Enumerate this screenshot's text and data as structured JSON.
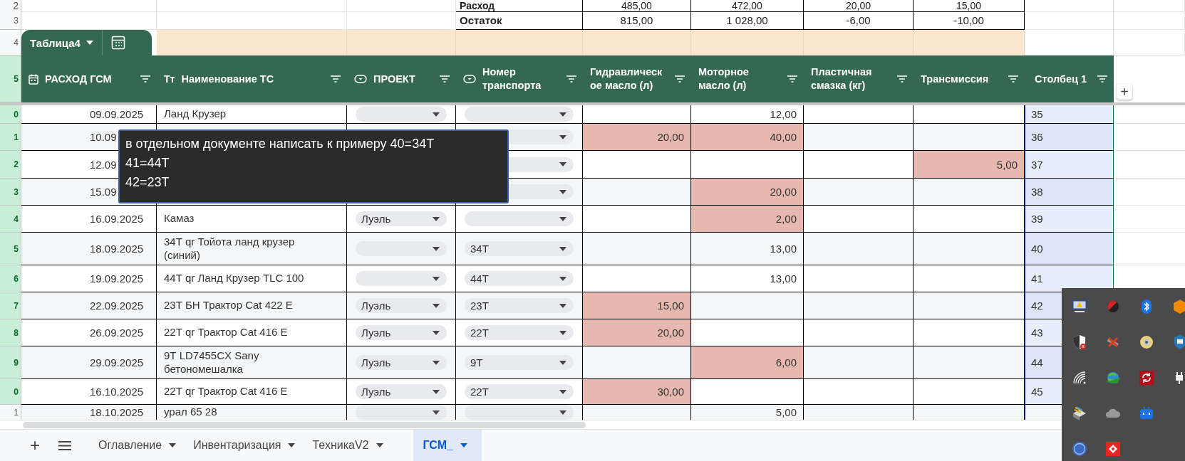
{
  "summary_rows": [
    {
      "row": "2",
      "label": "Расход",
      "values": [
        "485,00",
        "472,00",
        "20,00",
        "15,00"
      ]
    },
    {
      "row": "3",
      "label": "Остаток",
      "values": [
        "815,00",
        "1 028,00",
        "-6,00",
        "-10,00"
      ]
    }
  ],
  "table_tab": {
    "row": "4",
    "name": "Таблица4"
  },
  "header": {
    "row": "5",
    "add_column": "+",
    "columns": [
      {
        "label": "РАСХОД ГСМ",
        "kind": "date"
      },
      {
        "label": "Наименование ТС",
        "kind": "text",
        "icon_text": "Тт"
      },
      {
        "label": "ПРОЕКТ",
        "kind": "dropdown"
      },
      {
        "label": "Номер транспорта",
        "kind": "dropdown"
      },
      {
        "label": "Гидравлическое масло (л)",
        "kind": "plain"
      },
      {
        "label": "Моторное масло (л)",
        "kind": "plain"
      },
      {
        "label": "Пластичная смазка (кг)",
        "kind": "plain"
      },
      {
        "label": "Трансмиссия",
        "kind": "plain"
      },
      {
        "label": "Столбец 1",
        "kind": "centered"
      }
    ]
  },
  "rows": [
    {
      "row": "0",
      "selected": true,
      "date": "09.09.2025",
      "name": "Ланд Крузер",
      "values": [
        {
          "highlighted": false
        },
        {
          "text": "12,00",
          "highlighted": false
        },
        {
          "highlighted": false
        },
        {
          "highlighted": false
        }
      ],
      "index": {
        "text": "35",
        "selected": true
      }
    },
    {
      "row": "1",
      "selected": true,
      "date": "10.09",
      "values": [
        {
          "text": "20,00",
          "highlighted": true
        },
        {
          "text": "40,00",
          "highlighted": true
        },
        {
          "highlighted": false
        },
        {
          "highlighted": false
        }
      ],
      "index": {
        "text": "36",
        "selected": true
      }
    },
    {
      "row": "2",
      "selected": true,
      "date": "12.09",
      "values": [
        {
          "highlighted": false
        },
        {
          "highlighted": false
        },
        {
          "highlighted": false
        },
        {
          "text": "5,00",
          "highlighted": true
        }
      ],
      "index": {
        "text": "37",
        "selected": true
      }
    },
    {
      "row": "3",
      "selected": true,
      "date": "15.09",
      "values": [
        {
          "highlighted": false
        },
        {
          "text": "20,00",
          "highlighted": true
        },
        {
          "highlighted": false
        },
        {
          "highlighted": false
        }
      ],
      "index": {
        "text": "38",
        "selected": true
      }
    },
    {
      "row": "4",
      "selected": true,
      "date": "16.09.2025",
      "name": "Камаз",
      "project": "Луэль",
      "values": [
        {
          "highlighted": false
        },
        {
          "text": "2,00",
          "highlighted": true
        },
        {
          "highlighted": false
        },
        {
          "highlighted": false
        }
      ],
      "index": {
        "text": "39",
        "selected": true
      }
    },
    {
      "row": "5",
      "selected": true,
      "date": "18.09.2025",
      "name": "34Т qr Тойота ланд крузер (синий)",
      "number": "34Т",
      "values": [
        {
          "highlighted": false
        },
        {
          "text": "13,00",
          "highlighted": false
        },
        {
          "highlighted": false
        },
        {
          "highlighted": false
        }
      ],
      "index": {
        "text": "40",
        "selected": true
      }
    },
    {
      "row": "6",
      "selected": true,
      "date": "19.09.2025",
      "name": "44Т qr Ланд Крузер TLC 100",
      "number": "44Т",
      "values": [
        {
          "highlighted": false
        },
        {
          "text": "13,00",
          "highlighted": false
        },
        {
          "highlighted": false
        },
        {
          "highlighted": false
        }
      ],
      "index": {
        "text": "41",
        "selected": true
      }
    },
    {
      "row": "7",
      "selected": true,
      "date": "22.09.2025",
      "name": "23Т БН Трактор Cat 422 E",
      "project": "Луэль",
      "number": "23Т",
      "values": [
        {
          "text": "15,00",
          "highlighted": true
        },
        {
          "highlighted": false
        },
        {
          "highlighted": false
        },
        {
          "highlighted": false
        }
      ],
      "index": {
        "text": "42",
        "selected": true
      }
    },
    {
      "row": "8",
      "selected": true,
      "date": "26.09.2025",
      "name": "22Т qr Трактор Cat 416 E",
      "project": "Луэль",
      "number": "22Т",
      "values": [
        {
          "text": "20,00",
          "highlighted": true
        },
        {
          "highlighted": false
        },
        {
          "highlighted": false
        },
        {
          "highlighted": false
        }
      ],
      "index": {
        "text": "43",
        "selected": true
      }
    },
    {
      "row": "9",
      "selected": true,
      "date": "29.09.2025",
      "name": "9Т LD7455CX Sany бетономешалка",
      "project": "Луэль",
      "number": "9Т",
      "values": [
        {
          "highlighted": false
        },
        {
          "text": "6,00",
          "highlighted": true
        },
        {
          "highlighted": false
        },
        {
          "highlighted": false
        }
      ],
      "index": {
        "text": "44",
        "selected": true
      }
    },
    {
      "row": "0",
      "selected": true,
      "date": "16.10.2025",
      "name": "22Т qr Трактор Cat 416 E",
      "project": "Луэль",
      "number": "22Т",
      "values": [
        {
          "text": "30,00",
          "highlighted": true
        },
        {
          "highlighted": false
        },
        {
          "highlighted": false
        },
        {
          "highlighted": false
        }
      ],
      "index": {
        "text": "45",
        "selected": true
      }
    },
    {
      "row": "1",
      "selected": false,
      "date": "18.10.2025",
      "name": "урал 65 28",
      "values": [
        {
          "highlighted": false
        },
        {
          "text": "5,00",
          "highlighted": false
        },
        {
          "highlighted": false
        },
        {
          "highlighted": false
        }
      ],
      "index": {
        "selected": false
      }
    }
  ],
  "note": "в отдельном документе написать к примеру 40=34Т\n41=44Т\n42=23Т",
  "sheet_bar": {
    "add_sheet": "+",
    "tabs": [
      {
        "label": "Оглавление",
        "selected": false
      },
      {
        "label": "Инвентаризация",
        "selected": false
      },
      {
        "label": "ТехникаV2",
        "selected": false
      },
      {
        "label": "ГСМ_",
        "selected": true
      }
    ]
  }
}
